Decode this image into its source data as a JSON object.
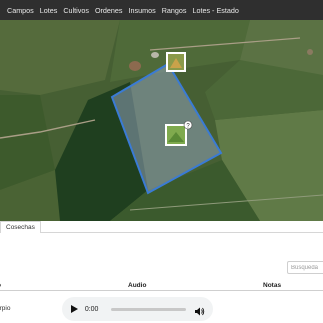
{
  "nav": {
    "items": [
      "Campos",
      "Lotes",
      "Cultivos",
      "Ordenes",
      "Insumos",
      "Rangos",
      "Lotes - Estado"
    ]
  },
  "map": {
    "polygon_color": "#3a7bd5",
    "markers": [
      {
        "icon": "photo-thumbnail-icon",
        "badge": ""
      },
      {
        "icon": "photo-thumbnail-icon",
        "badge": "?"
      }
    ]
  },
  "tabs": [
    {
      "label": "Cosechas"
    }
  ],
  "search": {
    "placeholder": "Búsqueda"
  },
  "table": {
    "columns": [
      "o",
      "Audio",
      "Notas"
    ],
    "rows": [
      {
        "name": "orpio"
      }
    ]
  },
  "audio": {
    "time": "0:00",
    "progress": 0.0
  }
}
